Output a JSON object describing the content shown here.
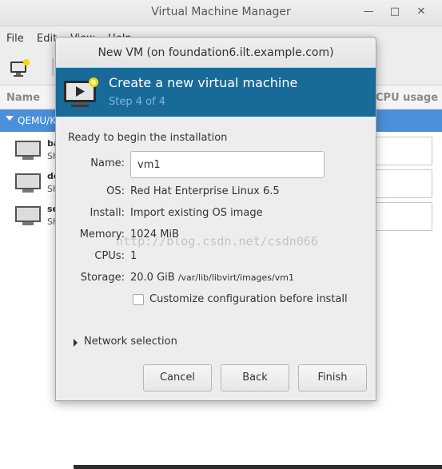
{
  "main_window": {
    "title": "Virtual Machine Manager",
    "menu": [
      "File",
      "Edit",
      "View",
      "Help"
    ],
    "list": {
      "col_name": "Name",
      "col_usage": "CPU usage",
      "group": "QEMU/KVM",
      "rows": [
        {
          "name": "ba",
          "status": "Sh"
        },
        {
          "name": "de",
          "status": "Sh"
        },
        {
          "name": "se",
          "status": "Sh"
        }
      ]
    }
  },
  "dialog": {
    "title": "New VM (on foundation6.ilt.example.com)",
    "banner_title": "Create a new virtual machine",
    "banner_step": "Step 4 of 4",
    "ready_text": "Ready to begin the installation",
    "name_label": "Name:",
    "name_value": "vm1",
    "os_label": "OS:",
    "os_value": "Red Hat Enterprise Linux 6.5",
    "install_label": "Install:",
    "install_value": "Import existing OS image",
    "memory_label": "Memory:",
    "memory_value": "1024 MiB",
    "cpus_label": "CPUs:",
    "cpus_value": "1",
    "storage_label": "Storage:",
    "storage_size": "20.0 GiB",
    "storage_path": "/var/lib/libvirt/images/vm1",
    "customize_label": "Customize configuration before install",
    "customize_checked": false,
    "network_label": "Network selection",
    "cancel_label": "Cancel",
    "back_label": "Back",
    "finish_label": "Finish"
  },
  "watermark": "http://blog.csdn.net/csdn066",
  "colors": {
    "banner": "#186a98",
    "banner_step": "#7fb6d8",
    "selection": "#4a90d9"
  }
}
